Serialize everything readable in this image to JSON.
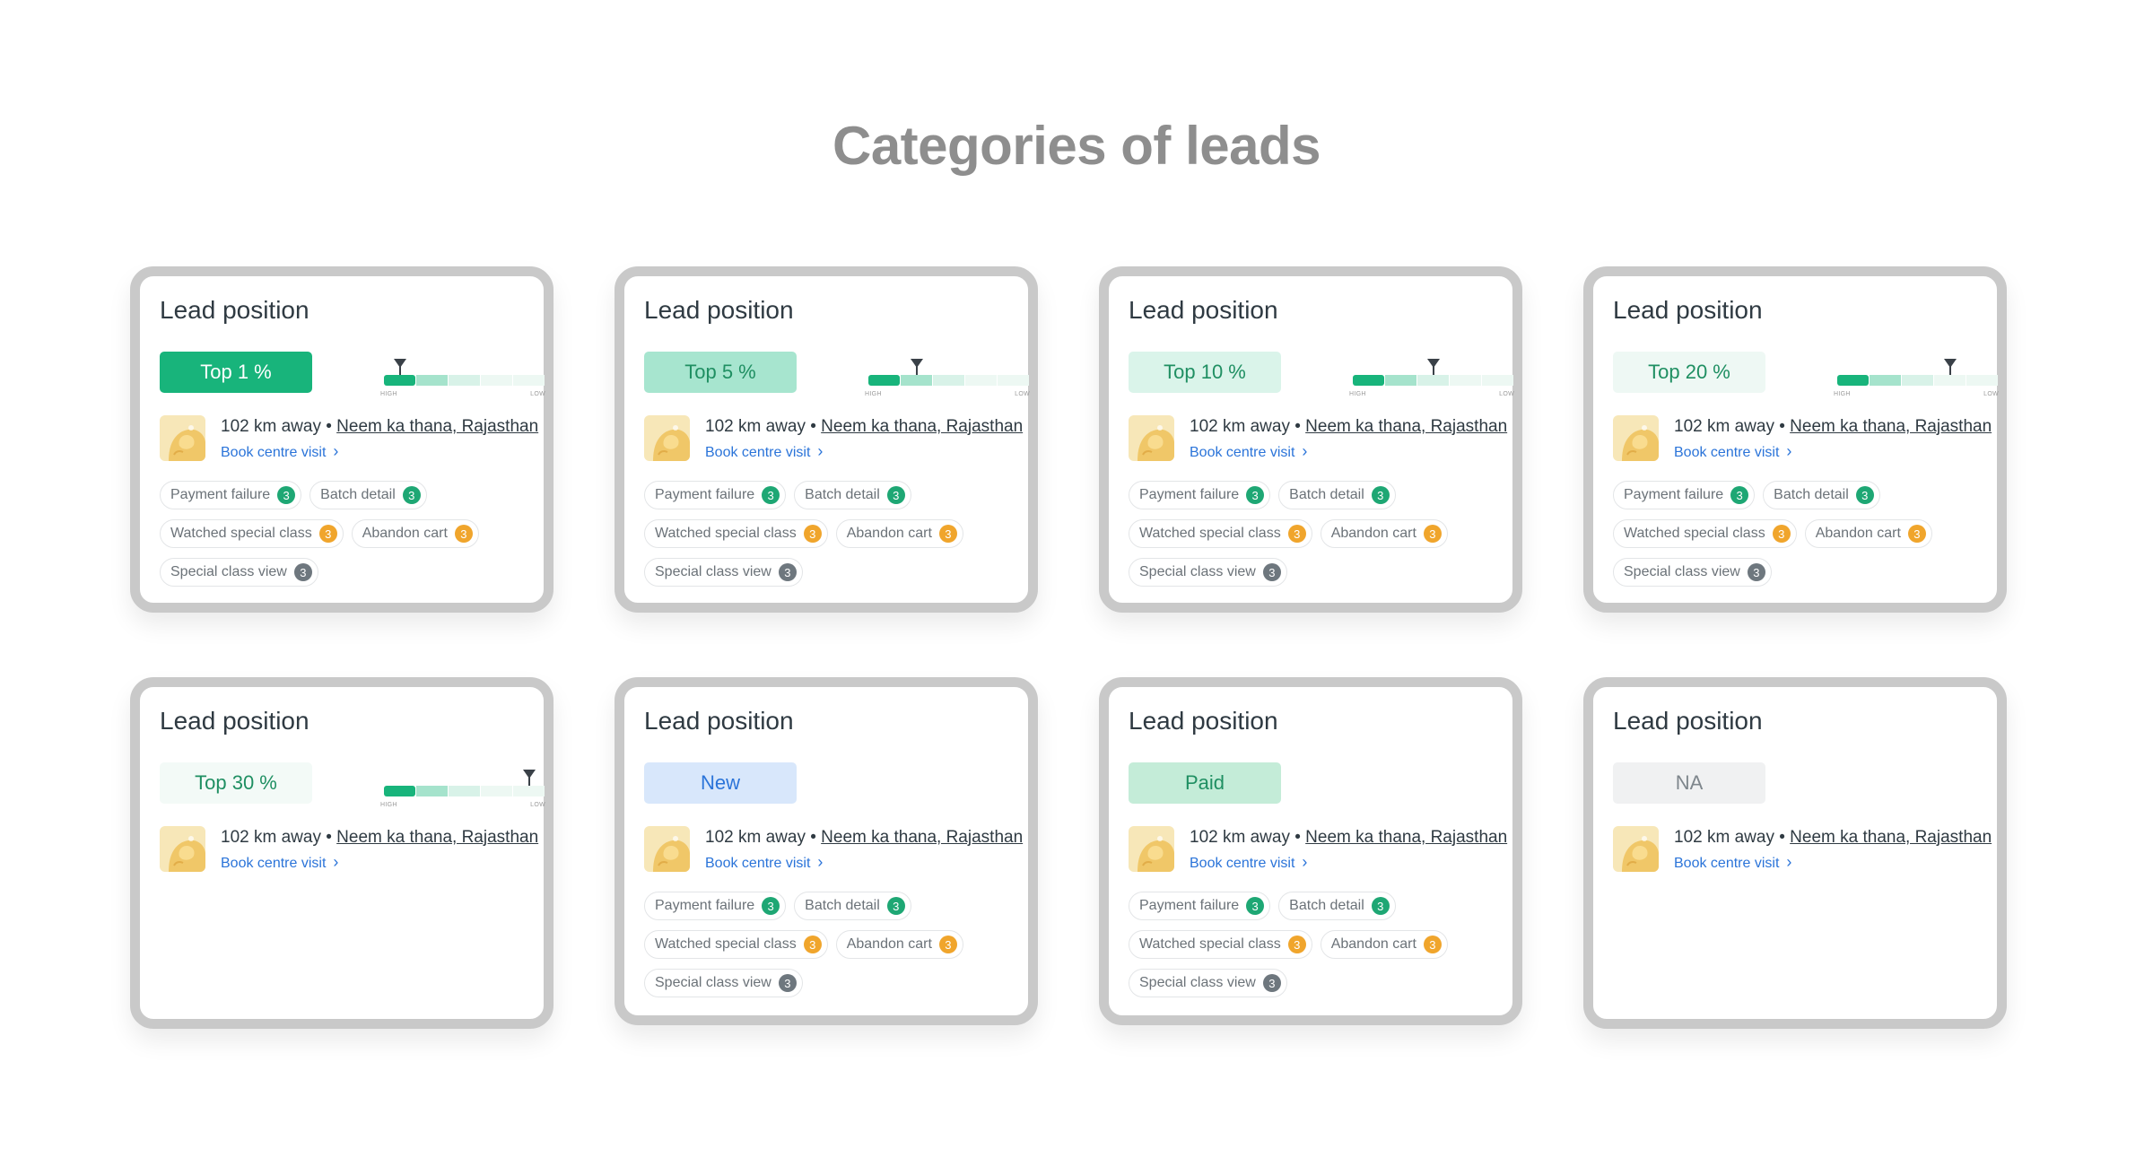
{
  "page": {
    "title": "Categories of leads"
  },
  "colors": {
    "card_border": "#c9c9c9",
    "meter_filled": "#18b47b",
    "meter_mid": "#a5e3cc",
    "meter_light": "#d8f2e8",
    "meter_pale": "#edf8f3",
    "link": "#2b74d9",
    "count_green": "#1ea774",
    "count_orange": "#f0a52c",
    "count_gray": "#6e777e"
  },
  "labels": {
    "card_title": "Lead position",
    "meter_high": "HIGH",
    "meter_low": "LOW",
    "distance": "102 km away",
    "separator": " • ",
    "place": "Neem ka thana, Rajasthan",
    "visit_link": "Book centre visit",
    "chevron": "›",
    "chip_payment": "Payment failure",
    "chip_batch": "Batch detail",
    "chip_watched": "Watched special class",
    "chip_abandon": "Abandon cart",
    "chip_special_view": "Special class view",
    "chip_count": "3"
  },
  "cards": [
    {
      "badge": "Top 1 %",
      "badge_bg": "#18b47b",
      "badge_fg": "#ffffff",
      "marker_fraction": 0.1,
      "show_meter": true,
      "show_chips": true
    },
    {
      "badge": "Top 5 %",
      "badge_bg": "#a7e5cf",
      "badge_fg": "#1f8f62",
      "marker_fraction": 0.3,
      "show_meter": true,
      "show_chips": true
    },
    {
      "badge": "Top 10 %",
      "badge_bg": "#daf4ea",
      "badge_fg": "#1f8f62",
      "marker_fraction": 0.5,
      "show_meter": true,
      "show_chips": true
    },
    {
      "badge": "Top 20 %",
      "badge_bg": "#eef8f4",
      "badge_fg": "#1f8f62",
      "marker_fraction": 0.7,
      "show_meter": true,
      "show_chips": true
    },
    {
      "badge": "Top 30 %",
      "badge_bg": "#f3faf7",
      "badge_fg": "#1f8f62",
      "marker_fraction": 0.9,
      "show_meter": true,
      "show_chips": false
    },
    {
      "badge": "New",
      "badge_bg": "#d8e7fb",
      "badge_fg": "#2b74d9",
      "marker_fraction": 0,
      "show_meter": false,
      "show_chips": true
    },
    {
      "badge": "Paid",
      "badge_bg": "#c4ecd8",
      "badge_fg": "#1f8f62",
      "marker_fraction": 0,
      "show_meter": false,
      "show_chips": true
    },
    {
      "badge": "NA",
      "badge_bg": "#f0f1f2",
      "badge_fg": "#7e868c",
      "marker_fraction": 0,
      "show_meter": false,
      "show_chips": false
    }
  ]
}
